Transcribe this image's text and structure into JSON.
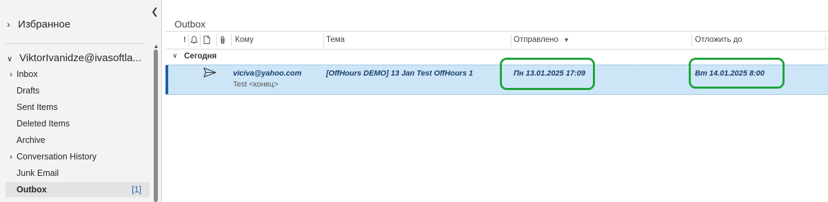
{
  "nav": {
    "favorites": "Избранное",
    "account": "ViktorIvanidze@ivasoftla...",
    "folders": [
      {
        "label": "Inbox",
        "expandable": true,
        "count": "",
        "selected": false
      },
      {
        "label": "Drafts",
        "expandable": false,
        "count": "",
        "selected": false
      },
      {
        "label": "Sent Items",
        "expandable": false,
        "count": "",
        "selected": false
      },
      {
        "label": "Deleted Items",
        "expandable": false,
        "count": "",
        "selected": false
      },
      {
        "label": "Archive",
        "expandable": false,
        "count": "",
        "selected": false
      },
      {
        "label": "Conversation History",
        "expandable": true,
        "count": "",
        "selected": false
      },
      {
        "label": "Junk Email",
        "expandable": false,
        "count": "",
        "selected": false
      },
      {
        "label": "Outbox",
        "expandable": false,
        "count": "[1]",
        "selected": true
      }
    ]
  },
  "folder_title": "Outbox",
  "columns": {
    "importance_icon": "!",
    "to": "Кому",
    "subject": "Тема",
    "sent": "Отправлено",
    "defer": "Отложить до"
  },
  "group": {
    "label": "Сегодня"
  },
  "message": {
    "to": "viciva@yahoo.com",
    "preview": "Test <конец>",
    "subject": "[OffHours DEMO] 13 Jan Test OffHours 1",
    "sent": "Пн 13.01.2025 17:09",
    "defer_until": "Вт 14.01.2025 8:00"
  },
  "colors": {
    "accent": "#1f5fa8",
    "selected_row": "#cde6f7",
    "highlight": "#1fa33a"
  },
  "icons": [
    "chevron-left-icon",
    "chevron-right-icon",
    "chevron-down-icon",
    "bell-icon",
    "document-icon",
    "paperclip-icon",
    "send-icon",
    "sort-descending-icon"
  ]
}
